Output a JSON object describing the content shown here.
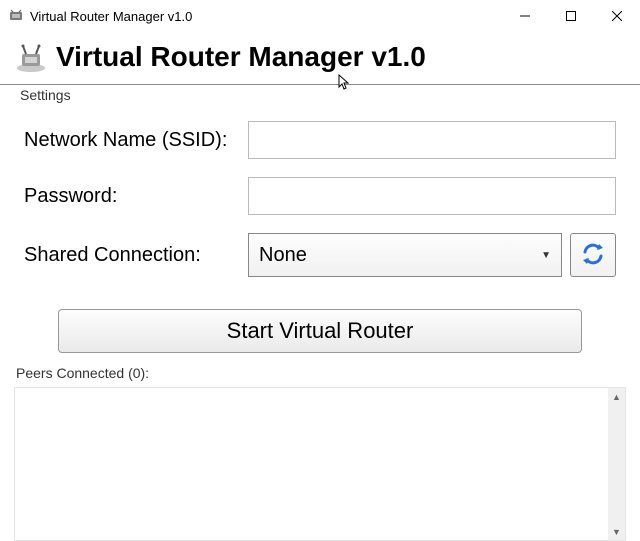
{
  "window": {
    "title": "Virtual Router Manager v1.0"
  },
  "header": {
    "title": "Virtual Router Manager v1.0"
  },
  "settings": {
    "legend": "Settings",
    "ssid_label": "Network Name (SSID):",
    "ssid_value": "",
    "password_label": "Password:",
    "password_value": "",
    "shared_label": "Shared Connection:",
    "shared_selected": "None"
  },
  "actions": {
    "start_label": "Start Virtual Router"
  },
  "peers": {
    "legend": "Peers Connected (0):",
    "count": 0
  }
}
